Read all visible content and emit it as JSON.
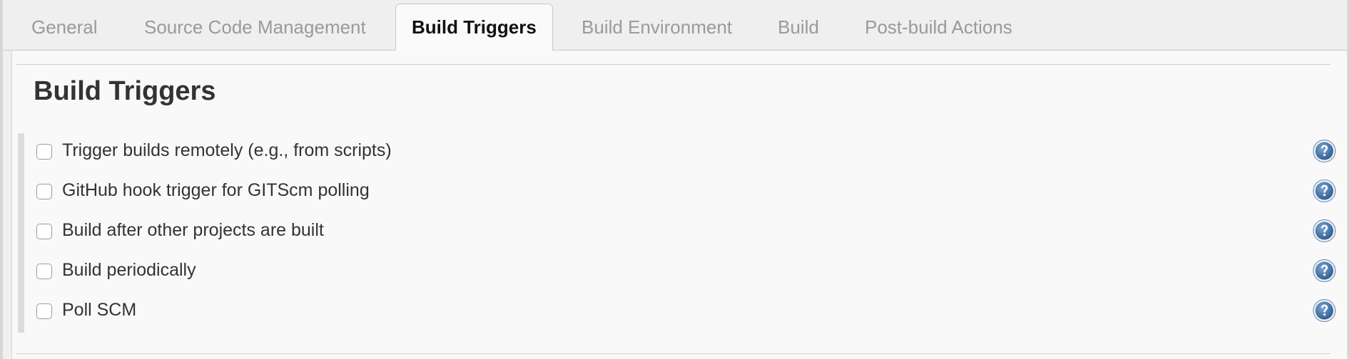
{
  "tabs": [
    {
      "label": "General",
      "active": false
    },
    {
      "label": "Source Code Management",
      "active": false
    },
    {
      "label": "Build Triggers",
      "active": true
    },
    {
      "label": "Build Environment",
      "active": false
    },
    {
      "label": "Build",
      "active": false
    },
    {
      "label": "Post-build Actions",
      "active": false
    }
  ],
  "section": {
    "title": "Build Triggers"
  },
  "options": [
    {
      "label": "Trigger builds remotely (e.g., from scripts)",
      "checked": false,
      "help_icon": "question-help-icon"
    },
    {
      "label": "GitHub hook trigger for GITScm polling",
      "checked": false,
      "help_icon": "question-help-icon"
    },
    {
      "label": "Build after other projects are built",
      "checked": false,
      "help_icon": "question-help-icon"
    },
    {
      "label": "Build periodically",
      "checked": false,
      "help_icon": "question-help-icon"
    },
    {
      "label": "Poll SCM",
      "checked": false,
      "help_icon": "question-help-icon"
    }
  ],
  "colors": {
    "active_tab_text": "#111111",
    "inactive_tab_text": "#9a9a9a",
    "help_icon_blue": "#3a6ea5"
  }
}
